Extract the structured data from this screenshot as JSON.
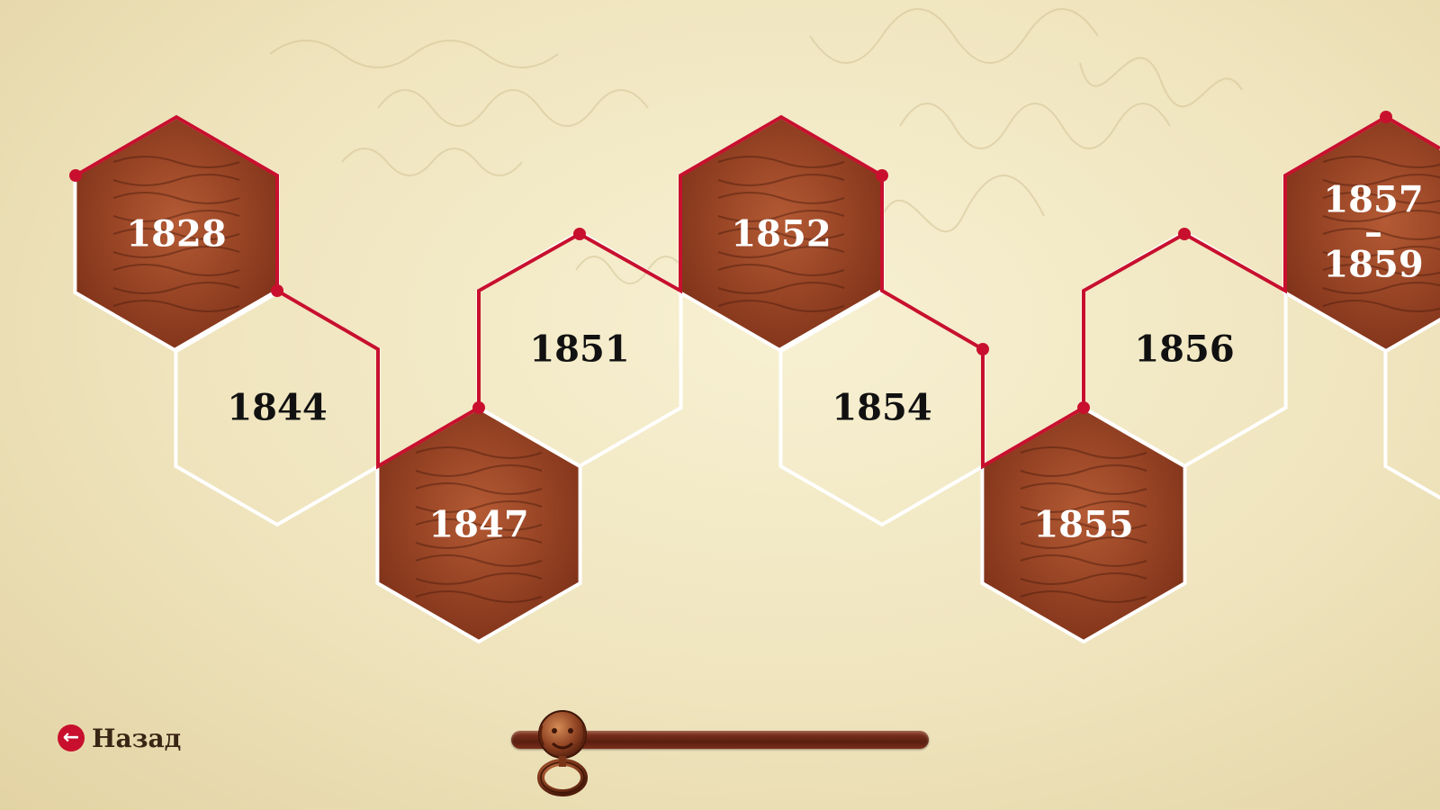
{
  "timeline": {
    "items": [
      {
        "label": "1828",
        "style": "image",
        "image": "child-in-winter-coat"
      },
      {
        "label": "1844",
        "style": "plain"
      },
      {
        "label": "1847",
        "style": "image",
        "image": "bearded-man-portrait"
      },
      {
        "label": "1851",
        "style": "plain"
      },
      {
        "label": "1852",
        "style": "image",
        "image": "wolf-illustration"
      },
      {
        "label": "1854",
        "style": "plain"
      },
      {
        "label": "1855",
        "style": "image",
        "image": "dancing-couple"
      },
      {
        "label": "1856",
        "style": "plain"
      },
      {
        "label": "1857 – 1859",
        "label_line1": "1857",
        "label_line2": "–",
        "label_line3": "1859",
        "style": "image",
        "image": "interior-scene"
      }
    ]
  },
  "navigation": {
    "back_label": "Назад",
    "back_icon": "arrow-left-circle-icon"
  },
  "slider": {
    "handle_icon": "lion-door-knocker-icon",
    "position": 0
  },
  "colors": {
    "accent_red": "#c8102e",
    "image_tint": "#a5482a",
    "outline": "#ffffff",
    "text_dark": "#111111",
    "slider_wood": "#6e2a16"
  }
}
